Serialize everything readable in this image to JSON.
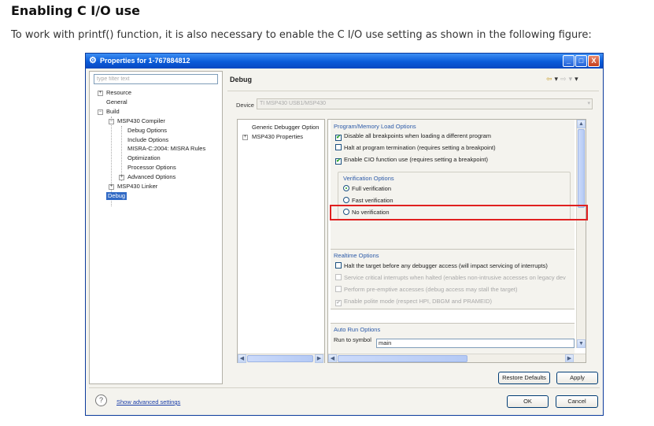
{
  "doc": {
    "title": "Enabling C I/O use",
    "intro": "To work with printf() function, it is also necessary to enable the C I/O use setting as shown in the following figure:"
  },
  "window": {
    "title": "Properties for 1-767884812",
    "min_glyph": "_",
    "max_glyph": "□",
    "close_glyph": "X"
  },
  "left": {
    "filter_placeholder": "type filter text",
    "tree": [
      {
        "label": "Resource"
      },
      {
        "label": "General"
      },
      {
        "label": "Build"
      },
      {
        "label": "MSP430 Compiler"
      },
      {
        "label": "Debug Options"
      },
      {
        "label": "Include Options"
      },
      {
        "label": "MISRA-C:2004: MISRA Rules"
      },
      {
        "label": "Optimization"
      },
      {
        "label": "Processor Options"
      },
      {
        "label": "Advanced Options"
      },
      {
        "label": "MSP430 Linker"
      },
      {
        "label": "Debug"
      }
    ]
  },
  "right": {
    "header": "Debug",
    "device_label": "Device",
    "device_value": "TI MSP430 USB1/MSP430",
    "cat_tree": [
      {
        "label": "Generic Debugger Option"
      },
      {
        "label": "MSP430 Properties"
      }
    ],
    "load": {
      "title": "Program/Memory Load Options",
      "options": [
        {
          "label": "Disable all breakpoints when loading a different program",
          "mark": "✔"
        },
        {
          "label": "Halt at program termination (requires setting a breakpoint)",
          "mark": ""
        },
        {
          "label": "Enable CIO function use (requires setting a breakpoint)",
          "mark": "✔"
        }
      ]
    },
    "verification": {
      "title": "Verification Options",
      "options": [
        {
          "label": "Full verification",
          "selected": true
        },
        {
          "label": "Fast verification",
          "selected": false
        },
        {
          "label": "No verification",
          "selected": false
        }
      ]
    },
    "realtime": {
      "title": "Realtime Options",
      "options": [
        {
          "label": "Halt the target before any debugger access (will impact servicing of interrupts)",
          "mark": ""
        },
        {
          "label": "Service critical interrupts when halted (enables non-intrusive accesses on legacy dev",
          "mark": ""
        },
        {
          "label": "Perform pre-emptive accesses (debug access may stall the target)",
          "mark": ""
        },
        {
          "label": "Enable polite mode (respect HPI, DBGM and PRAMEID)",
          "mark": "✔"
        }
      ]
    },
    "autorun": {
      "title": "Auto Run Options",
      "run_label": "Run to symbol",
      "run_value": "main"
    }
  },
  "buttons": {
    "restore": "Restore Defaults",
    "apply": "Apply",
    "ok": "OK",
    "cancel": "Cancel",
    "help_glyph": "?",
    "advanced": "Show advanced settings"
  },
  "nav": {
    "back": "⇦",
    "forward": "⇨",
    "dropdown": "▾"
  }
}
